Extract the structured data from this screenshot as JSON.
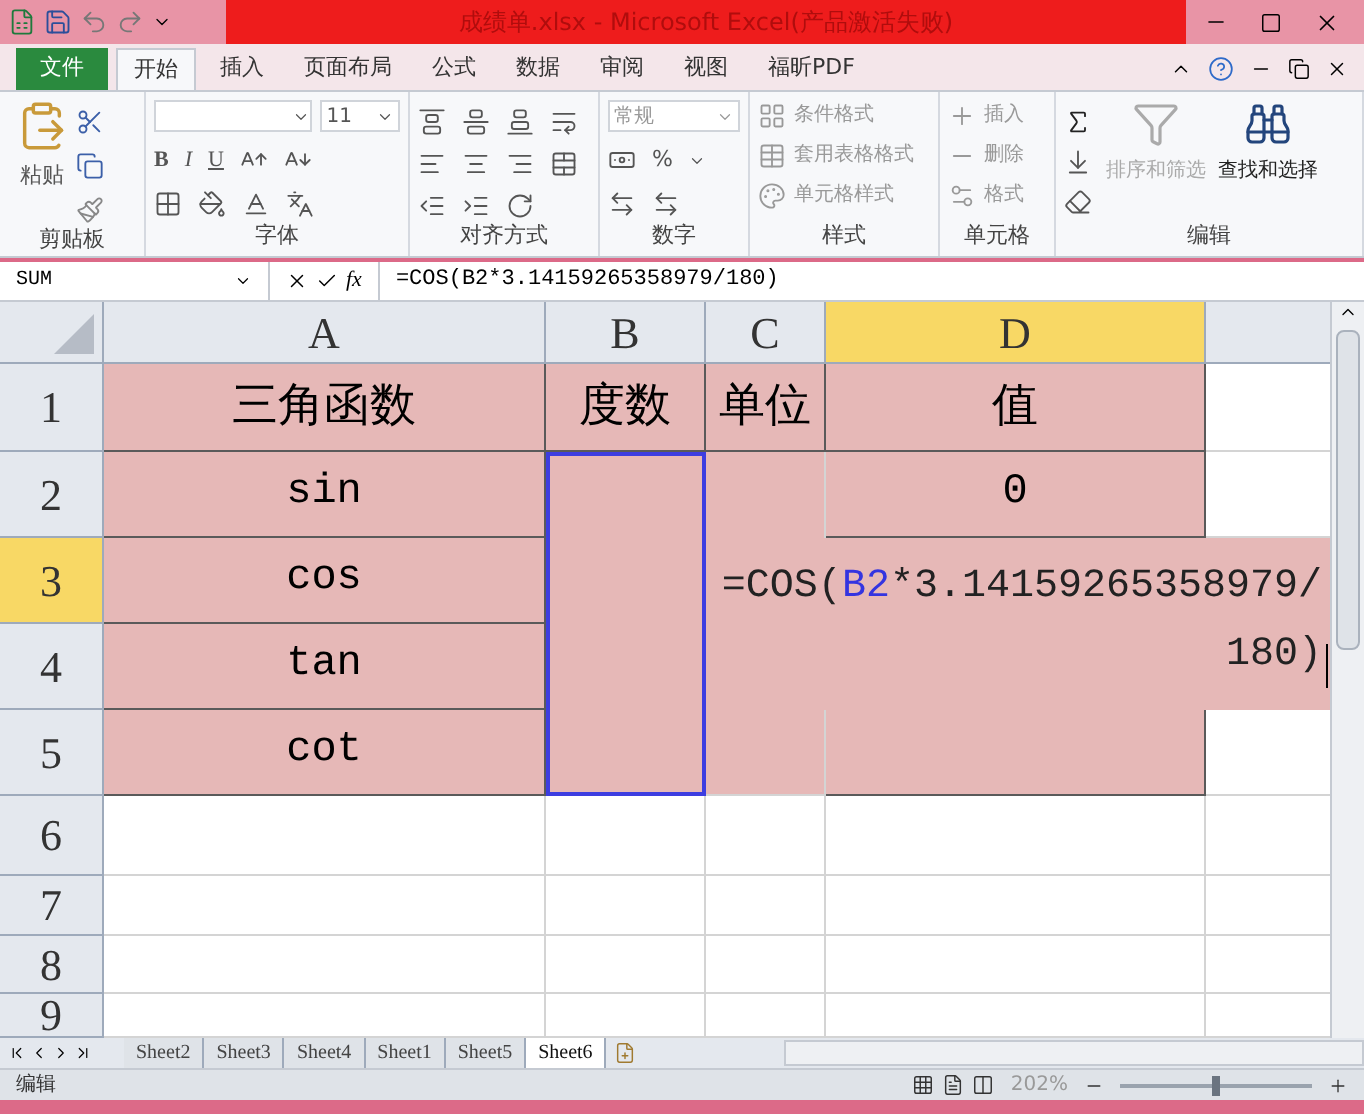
{
  "window": {
    "title": "成绩单.xlsx - Microsoft Excel(产品激活失败)"
  },
  "ribbon_tabs": [
    {
      "label": "文件",
      "kind": "file",
      "selected": false
    },
    {
      "label": "开始",
      "kind": "tab",
      "selected": true
    },
    {
      "label": "插入",
      "kind": "tab",
      "selected": false
    },
    {
      "label": "页面布局",
      "kind": "tab",
      "selected": false
    },
    {
      "label": "公式",
      "kind": "tab",
      "selected": false
    },
    {
      "label": "数据",
      "kind": "tab",
      "selected": false
    },
    {
      "label": "审阅",
      "kind": "tab",
      "selected": false
    },
    {
      "label": "视图",
      "kind": "tab",
      "selected": false
    },
    {
      "label": "福昕PDF",
      "kind": "tab",
      "selected": false
    }
  ],
  "ribbon": {
    "clipboard": {
      "paste": "粘贴",
      "label": "剪贴板"
    },
    "font": {
      "size": "11",
      "bold": "B",
      "italic": "I",
      "underline": "U",
      "label": "字体"
    },
    "alignment": {
      "label": "对齐方式"
    },
    "number": {
      "format": "常规",
      "percent": "%",
      "label": "数字"
    },
    "styles": {
      "items": [
        "条件格式",
        "套用表格格式",
        "单元格样式"
      ],
      "label": "样式"
    },
    "cells": {
      "items": [
        "插入",
        "删除",
        "格式"
      ],
      "label": "单元格"
    },
    "editing": {
      "sort": "排序和筛选",
      "find": "查找和选择",
      "label": "编辑"
    }
  },
  "formula_bar": {
    "name_box": "SUM",
    "function_label": "fx",
    "formula": "=COS(B2*3.14159265358979/180)"
  },
  "columns": [
    {
      "label": "A",
      "selected": false
    },
    {
      "label": "B",
      "selected": false
    },
    {
      "label": "C",
      "selected": false
    },
    {
      "label": "D",
      "selected": true
    }
  ],
  "rows": [
    {
      "label": "1",
      "selected": false,
      "filled": true,
      "cells": [
        "三角函数",
        "度数",
        "单位",
        "值"
      ]
    },
    {
      "label": "2",
      "selected": false,
      "filled": true,
      "cells": [
        "sin",
        null,
        null,
        "0"
      ]
    },
    {
      "label": "3",
      "selected": true,
      "filled": true,
      "cells": [
        "cos",
        null,
        null,
        null
      ]
    },
    {
      "label": "4",
      "selected": false,
      "filled": true,
      "cells": [
        "tan",
        null,
        null,
        null
      ]
    },
    {
      "label": "5",
      "selected": false,
      "filled": true,
      "cells": [
        "cot",
        null,
        null,
        null
      ]
    },
    {
      "label": "6",
      "selected": false,
      "filled": false,
      "cells": []
    },
    {
      "label": "7",
      "selected": false,
      "filled": false,
      "cells": []
    },
    {
      "label": "8",
      "selected": false,
      "filled": false,
      "cells": []
    },
    {
      "label": "9",
      "selected": false,
      "filled": false,
      "cells": []
    }
  ],
  "cell_editor": {
    "parts": [
      {
        "text": "=COS(",
        "kind": "plain"
      },
      {
        "text": "B2",
        "kind": "ref"
      },
      {
        "text": "*3.14159265358979/180)",
        "kind": "plain"
      }
    ]
  },
  "sheet_tabs": [
    {
      "label": "Sheet2",
      "selected": false
    },
    {
      "label": "Sheet3",
      "selected": false
    },
    {
      "label": "Sheet4",
      "selected": false
    },
    {
      "label": "Sheet1",
      "selected": false
    },
    {
      "label": "Sheet5",
      "selected": false
    },
    {
      "label": "Sheet6",
      "selected": true
    }
  ],
  "status_bar": {
    "mode": "编辑",
    "zoom": "202%",
    "zoom_slider": {
      "level": 0.5
    }
  }
}
